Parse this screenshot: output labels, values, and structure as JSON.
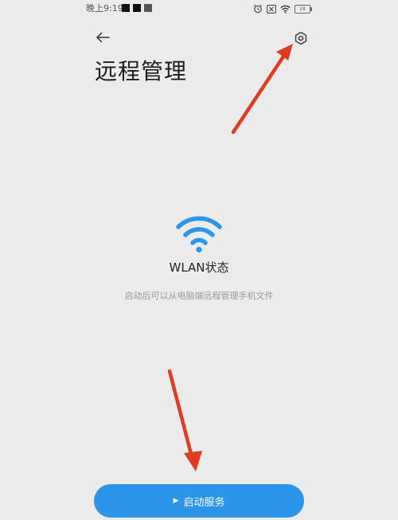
{
  "status_bar": {
    "time": "晚上9:19",
    "square_colors": [
      "#111111",
      "#111111",
      "#555555"
    ],
    "battery_level": "28",
    "icons": [
      "alarm-icon",
      "sim-x-icon",
      "wifi-icon",
      "battery-icon"
    ]
  },
  "header": {
    "back_icon": "arrow-left-icon",
    "settings_icon": "gear-icon",
    "title": "远程管理"
  },
  "main": {
    "status_icon": "wifi-icon",
    "status_label": "WLAN状态",
    "description": "启动后可以从电脑端远程管理手机文件"
  },
  "action": {
    "play_icon": "play-icon",
    "start_label": "启动服务"
  },
  "colors": {
    "accent": "#2b96e9",
    "background": "#ececec",
    "annotation": "#e23b22"
  }
}
